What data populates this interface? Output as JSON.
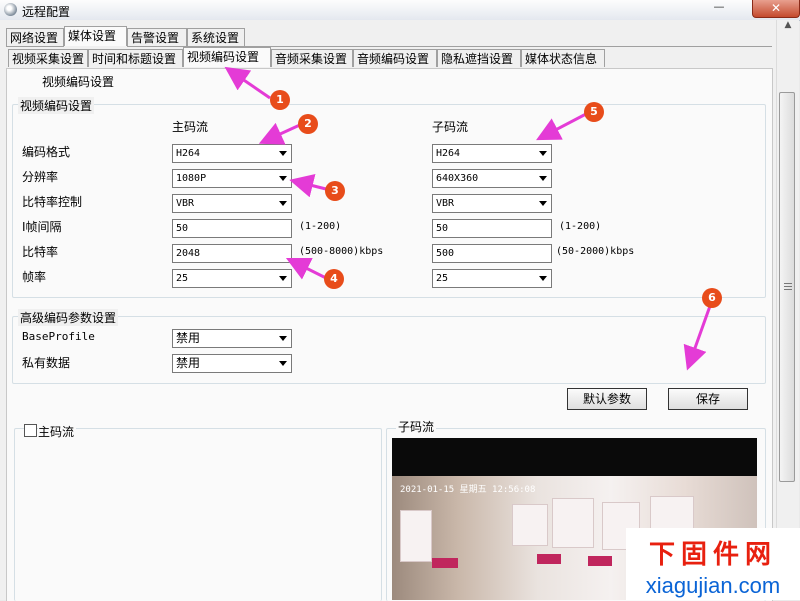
{
  "window": {
    "title": "远程配置",
    "close_glyph": "✕",
    "minimize_glyph": "—"
  },
  "top_tabs": [
    "网络设置",
    "媒体设置",
    "告警设置",
    "系统设置"
  ],
  "sub_tabs": [
    "视频采集设置",
    "时间和标题设置",
    "视频编码设置",
    "音频采集设置",
    "音频编码设置",
    "隐私遮挡设置",
    "媒体状态信息"
  ],
  "page_heading": "视频编码设置",
  "encoding": {
    "group_title": "视频编码设置",
    "main_stream_header": "主码流",
    "sub_stream_header": "子码流",
    "rows": [
      {
        "label": "编码格式"
      },
      {
        "label": "分辨率"
      },
      {
        "label": "比特率控制"
      },
      {
        "label": "I帧间隔"
      },
      {
        "label": "比特率"
      },
      {
        "label": "帧率"
      }
    ],
    "main": {
      "codec": "H264",
      "resolution": "1080P",
      "bitrate_control": "VBR",
      "iframe_interval": "50",
      "bitrate": "2048",
      "framerate": "25",
      "iframe_range": "(1-200)",
      "bitrate_range": "(500-8000)kbps"
    },
    "sub": {
      "codec": "H264",
      "resolution": "640X360",
      "bitrate_control": "VBR",
      "iframe_interval": "50",
      "bitrate": "500",
      "framerate": "25",
      "iframe_range": "(1-200)",
      "bitrate_range": "(50-2000)kbps"
    }
  },
  "advanced": {
    "group_title": "高级编码参数设置",
    "baseprofile_label": "BaseProfile",
    "baseprofile_value": "禁用",
    "private_data_label": "私有数据",
    "private_data_value": "禁用"
  },
  "buttons": {
    "default": "默认参数",
    "save": "保存"
  },
  "preview": {
    "main_checkbox_label": "主码流",
    "sub_label": "子码流",
    "osd_text": "2021-01-15 星期五 12:56:08"
  },
  "annotations": [
    "1",
    "2",
    "3",
    "4",
    "5",
    "6"
  ],
  "watermark": {
    "cn": "下固件网",
    "en": "xiagujian.com"
  },
  "colors": {
    "annotation_arrow": "#e43bd6",
    "annotation_badge": "#e84c1a",
    "watermark_red": "#e8200f",
    "watermark_blue": "#0a64d6"
  },
  "icons": [
    "app-icon",
    "dropdown-arrow-icon",
    "scroll-up-icon",
    "scroll-grip-icon"
  ]
}
